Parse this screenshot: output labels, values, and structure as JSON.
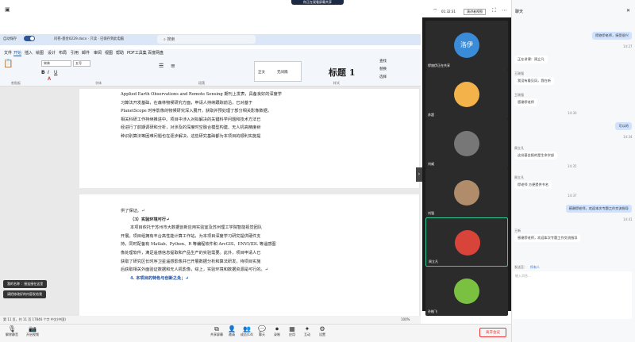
{
  "meeting": {
    "timer": "01:32:31",
    "speaker_view": "演讲者视图",
    "share_banner": "你正在观看屏幕共享"
  },
  "word": {
    "autosave": "自动保存",
    "toggle": "关",
    "docname": "问卷-基金0229.docx · 只读 · 已保存到此电脑",
    "search_placeholder": "搜索",
    "menus": [
      "文件",
      "开始",
      "插入",
      "绘图",
      "设计",
      "布局",
      "引用",
      "邮件",
      "审阅",
      "视图",
      "帮助",
      "PDF工具集",
      "百度网盘"
    ],
    "active_menu": "开始",
    "ribbon": {
      "font": "宋体",
      "size": "五号",
      "style1": "正文",
      "style2": "无间隔",
      "style3": "标题 1",
      "groups": [
        "剪贴板",
        "字体",
        "段落",
        "样式"
      ],
      "find": "查找",
      "replace": "替换",
      "select": "选择"
    },
    "page1_lines": [
      "Applied Earth Observations and Remote Sensing 期刊上发表，具备良好的深度学",
      "习算法开发基础，在森林物候研究方面，申请人持续跟踪前沿，已对基于",
      "PlanetScope 时序影像的物候研究深入展开，获取并预处理了部分相关影像数据，",
      "相关科研工作持续推进中。项目中涉入对拟解决的关键科学问题和技术方法已",
      "经进行了前期调研和分析，对涉及的深度时空融合模型构建、无人机高精度树",
      "种识别算法等困难问题也在逐步解决，这些研究基础都为本项目的顺利实施提"
    ],
    "page2_lines": [
      "供了保证。↵",
      "（3）实验环境可行↵",
      "本项目依托于苏州市大数据创新应用实验室及苏州理工学院智能视觉团队",
      "开展。项目组拥有丰台高性能计算工作站，为本项目深度学习研究提供硬件支",
      "持，同时配备有 Matlab、Python、R 等编程软件和 ArcGIS、ENVI/IDL 等遥感图",
      "像处理软件，满足遥感信息提取和产品生产的实验需要。此外，项目申请人已",
      "获取了研究区长时序卫星遥感影像并已开展数据分析和算法研发，待项目实施",
      "后获取相关外面验证数据和无人机影像，综上，实验环境和数据资源是可行的。↵"
    ],
    "heading4": "4. 本项目的特色与创新之处；↵",
    "status": "第 11 页，共 11 页    17846 个字    中文(中国)",
    "zoom": "100%"
  },
  "toasts": [
    "我的名称 ：接连接在这里",
    "请把修改好的内容发给我"
  ],
  "participants": [
    {
      "name": "缪旅伊正在共享",
      "avatar_text": "洛伊",
      "color": "#3a8bd8"
    },
    {
      "name": "苏超",
      "avatar_text": "",
      "color": "#f3b24a"
    },
    {
      "name": "刘威",
      "avatar_text": "",
      "color": "#777"
    },
    {
      "name": "刘强",
      "avatar_text": "",
      "color": "#b08c6a"
    },
    {
      "name": "周立凡",
      "avatar_text": "",
      "color": "#d9443a"
    },
    {
      "name": "孙楷飞",
      "avatar_text": "",
      "color": "#7ac142"
    }
  ],
  "chat": {
    "title": "聊天",
    "messages": [
      {
        "side": "right",
        "text": "缪旅伊老师，接受很兴",
        "time": "14:27"
      },
      {
        "side": "left",
        "sender": "",
        "text": "正在讲课：周立凡",
        "time": ""
      },
      {
        "side": "left",
        "sender": "王刚强",
        "text": "我没有看见风，我在听",
        "time": ""
      },
      {
        "side": "left",
        "sender": "王刚强",
        "text": "感谢缪老师",
        "time": "14:30"
      },
      {
        "side": "right",
        "text": "可以的",
        "time": "14:34"
      },
      {
        "side": "left",
        "sender": "周立凡",
        "text": "这份基金报的是生命学部",
        "time": "14:35"
      },
      {
        "side": "left",
        "sender": "周立凡",
        "text": "缪老师 方便提供书名",
        "time": "14:37"
      },
      {
        "side": "right",
        "text": "感谢缪老师，欢迎本次专题工作交流指导",
        "time": "14:41"
      },
      {
        "side": "left",
        "sender": "王新",
        "text": "感谢缪老师，欢迎本次专题工作交流指导",
        "time": ""
      }
    ],
    "send_to_label": "发送至：",
    "send_to": "所有人",
    "input_placeholder": "输入消息..."
  },
  "toolbar": {
    "left": [
      "解除静音",
      "开启视频"
    ],
    "center": [
      "共享屏幕",
      "邀请",
      "成员(14)",
      "聊天",
      "录制",
      "应用",
      "互动",
      "设置"
    ],
    "leave": "离开会议"
  }
}
